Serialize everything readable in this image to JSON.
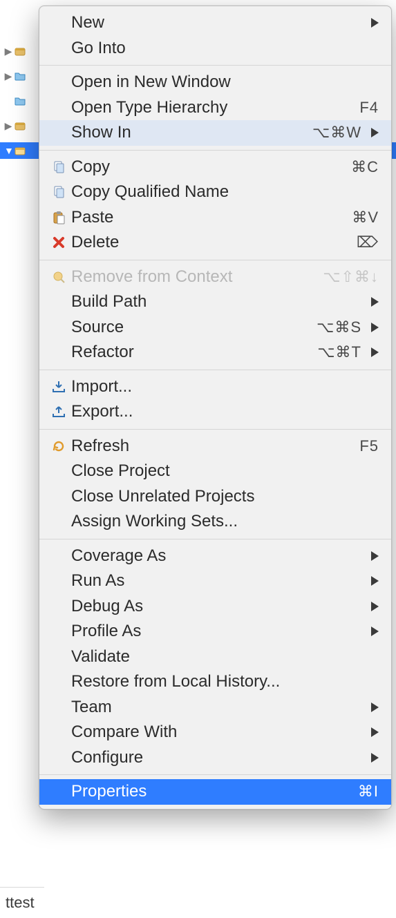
{
  "tree": {
    "rows": [
      {
        "expanded": false
      },
      {
        "expanded": false
      },
      {
        "expanded": false
      },
      {
        "expanded": false
      },
      {
        "expanded": true,
        "selected": true
      }
    ]
  },
  "bottom_tab": {
    "label": "ttest"
  },
  "menu": {
    "groups": [
      [
        {
          "label": "New",
          "submenu": true
        },
        {
          "label": "Go Into"
        }
      ],
      [
        {
          "label": "Open in New Window"
        },
        {
          "label": "Open Type Hierarchy",
          "shortcut": "F4"
        },
        {
          "label": "Show In",
          "shortcut": "⌥⌘W",
          "submenu": true,
          "hover": true
        }
      ],
      [
        {
          "label": "Copy",
          "icon": "copy",
          "shortcut": "⌘C"
        },
        {
          "label": "Copy Qualified Name",
          "icon": "copy"
        },
        {
          "label": "Paste",
          "icon": "paste",
          "shortcut": "⌘V"
        },
        {
          "label": "Delete",
          "icon": "delete",
          "shortcut": "⌦"
        }
      ],
      [
        {
          "label": "Remove from Context",
          "icon": "remove-ctx",
          "shortcut": "⌥⇧⌘↓",
          "disabled": true
        },
        {
          "label": "Build Path",
          "submenu": true
        },
        {
          "label": "Source",
          "shortcut": "⌥⌘S",
          "submenu": true
        },
        {
          "label": "Refactor",
          "shortcut": "⌥⌘T",
          "submenu": true
        }
      ],
      [
        {
          "label": "Import...",
          "icon": "import"
        },
        {
          "label": "Export...",
          "icon": "export"
        }
      ],
      [
        {
          "label": "Refresh",
          "icon": "refresh",
          "shortcut": "F5"
        },
        {
          "label": "Close Project"
        },
        {
          "label": "Close Unrelated Projects"
        },
        {
          "label": "Assign Working Sets..."
        }
      ],
      [
        {
          "label": "Coverage As",
          "submenu": true
        },
        {
          "label": "Run As",
          "submenu": true
        },
        {
          "label": "Debug As",
          "submenu": true
        },
        {
          "label": "Profile As",
          "submenu": true
        },
        {
          "label": "Validate"
        },
        {
          "label": "Restore from Local History..."
        },
        {
          "label": "Team",
          "submenu": true
        },
        {
          "label": "Compare With",
          "submenu": true
        },
        {
          "label": "Configure",
          "submenu": true
        }
      ],
      [
        {
          "label": "Properties",
          "shortcut": "⌘I",
          "selected": true
        }
      ]
    ]
  }
}
